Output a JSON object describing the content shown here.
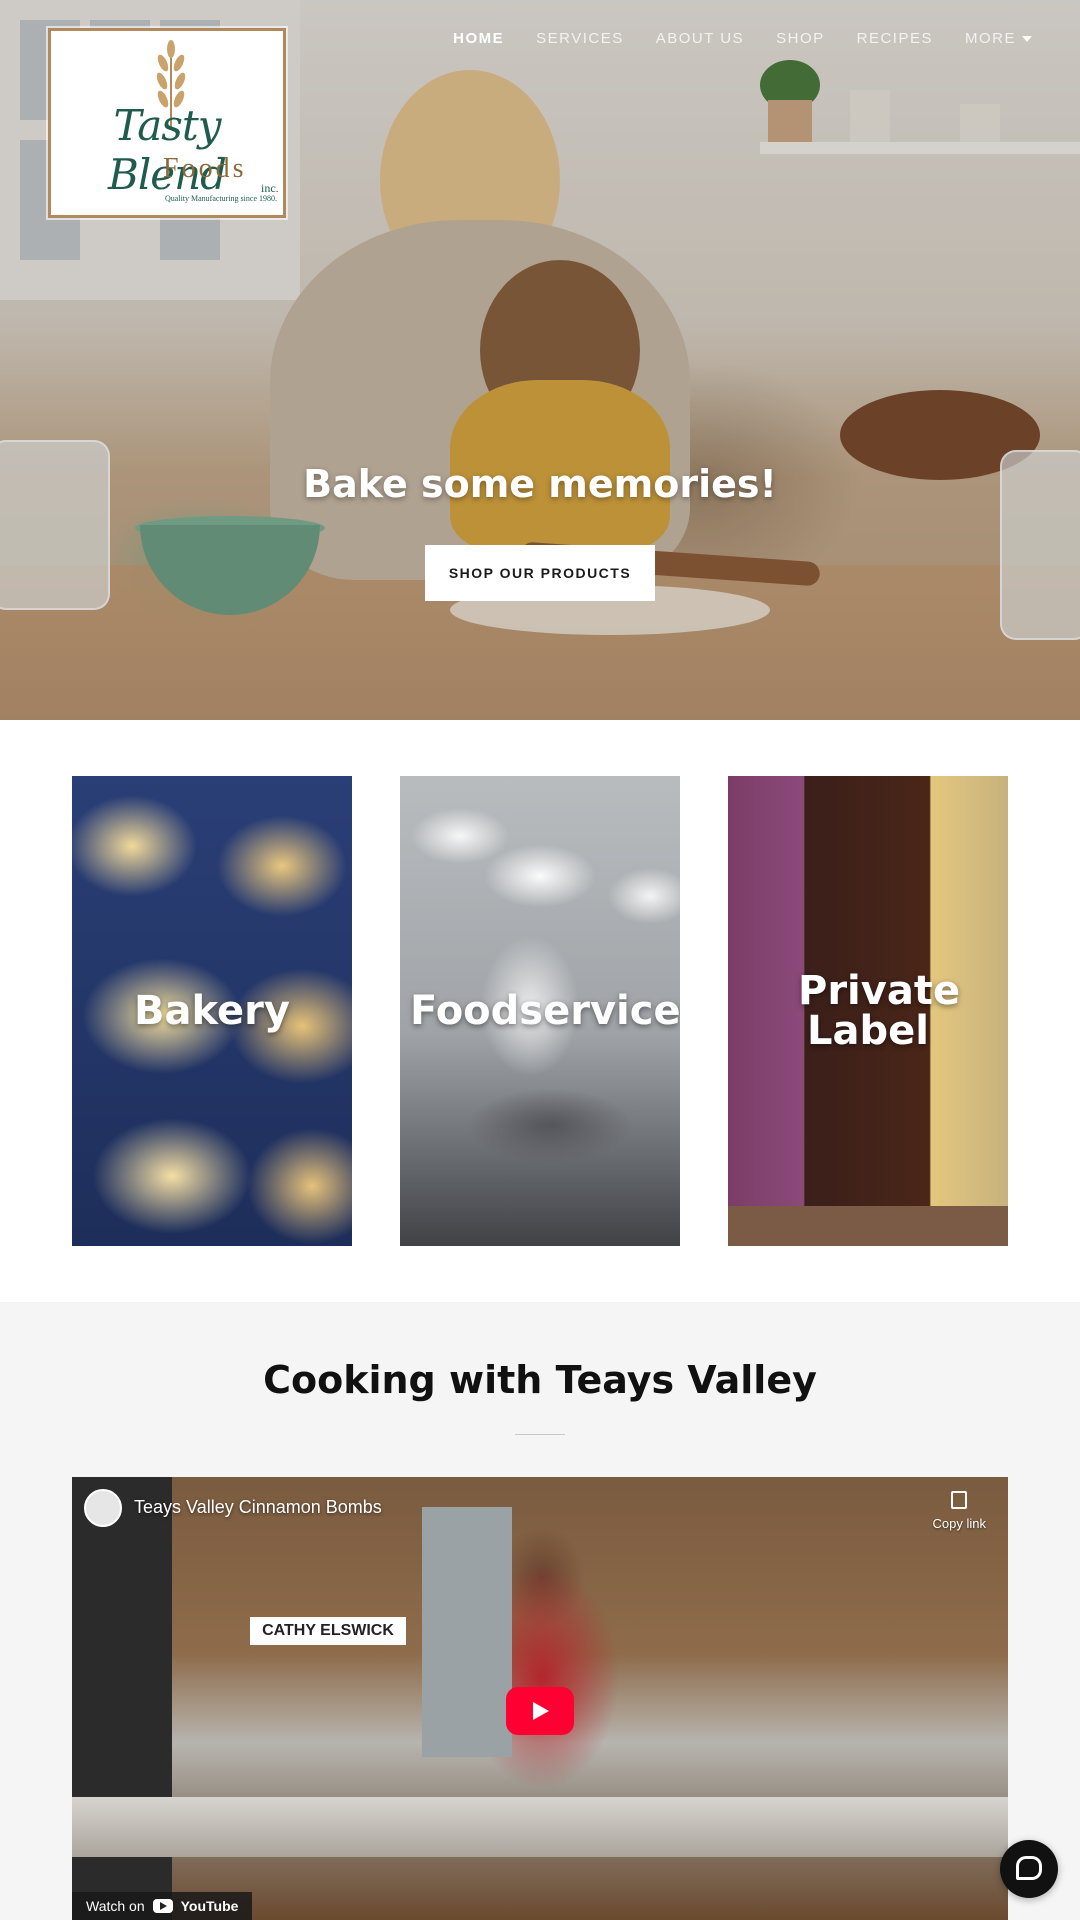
{
  "logo": {
    "title": "Tasty Blend",
    "subtitle": "Foods",
    "inc": "inc.",
    "tagline": "Quality Manufacturing since 1980."
  },
  "nav": {
    "items": [
      {
        "label": "HOME",
        "active": true
      },
      {
        "label": "SERVICES",
        "active": false
      },
      {
        "label": "ABOUT US",
        "active": false
      },
      {
        "label": "SHOP",
        "active": false
      },
      {
        "label": "RECIPES",
        "active": false
      },
      {
        "label": "MORE",
        "active": false
      }
    ]
  },
  "hero": {
    "title": "Bake some memories!",
    "button_label": "SHOP OUR PRODUCTS"
  },
  "tiles": [
    {
      "label": "Bakery"
    },
    {
      "label": "Foodservice"
    },
    {
      "label": "Private Label"
    }
  ],
  "video_section": {
    "title": "Cooking with Teays Valley",
    "video": {
      "title": "Teays Valley Cinnamon Bombs",
      "copy_link": "Copy link",
      "name_tag": "CATHY ELSWICK",
      "watch_on": "Watch on",
      "youtube": "YouTube"
    }
  },
  "colors": {
    "brand_green": "#1f5c4d",
    "brand_gold": "#8a6a3a",
    "youtube_red": "#ff0033",
    "section_bg": "#f5f5f5"
  },
  "icons": [
    "caret-down-icon",
    "copy-icon",
    "play-icon",
    "youtube-icon",
    "chat-icon",
    "wheat-icon"
  ]
}
